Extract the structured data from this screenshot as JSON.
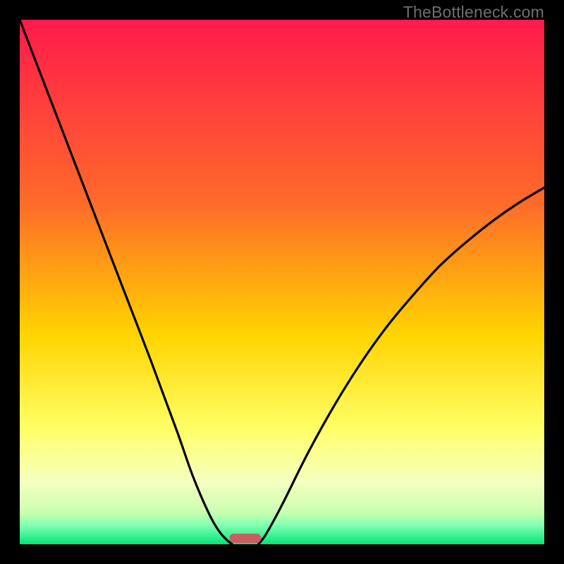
{
  "watermark": "TheBottleneck.com",
  "chart_data": {
    "type": "line",
    "title": "",
    "xlabel": "",
    "ylabel": "",
    "xlim": [
      0,
      1
    ],
    "ylim": [
      0,
      1
    ],
    "background_gradient": [
      {
        "stop": 0.0,
        "color": "#ff1a4b"
      },
      {
        "stop": 0.35,
        "color": "#ff6a2a"
      },
      {
        "stop": 0.6,
        "color": "#ffd400"
      },
      {
        "stop": 0.78,
        "color": "#ffff66"
      },
      {
        "stop": 0.88,
        "color": "#f5ffbf"
      },
      {
        "stop": 0.94,
        "color": "#c8ffb0"
      },
      {
        "stop": 0.965,
        "color": "#7dffb0"
      },
      {
        "stop": 1.0,
        "color": "#00e676"
      }
    ],
    "series": [
      {
        "name": "left-curve",
        "x": [
          0.0,
          0.05,
          0.1,
          0.15,
          0.2,
          0.25,
          0.3,
          0.33,
          0.36,
          0.38,
          0.395,
          0.405
        ],
        "y": [
          1.0,
          0.87,
          0.74,
          0.61,
          0.48,
          0.35,
          0.215,
          0.13,
          0.06,
          0.025,
          0.008,
          0.0
        ]
      },
      {
        "name": "right-curve",
        "x": [
          0.455,
          0.47,
          0.5,
          0.55,
          0.6,
          0.65,
          0.7,
          0.75,
          0.8,
          0.85,
          0.9,
          0.95,
          1.0
        ],
        "y": [
          0.0,
          0.02,
          0.075,
          0.175,
          0.265,
          0.345,
          0.415,
          0.475,
          0.53,
          0.575,
          0.615,
          0.65,
          0.68
        ]
      }
    ],
    "marker": {
      "name": "bottleneck-marker",
      "x_center": 0.43,
      "width": 0.06,
      "color": "#cc5c62"
    }
  }
}
